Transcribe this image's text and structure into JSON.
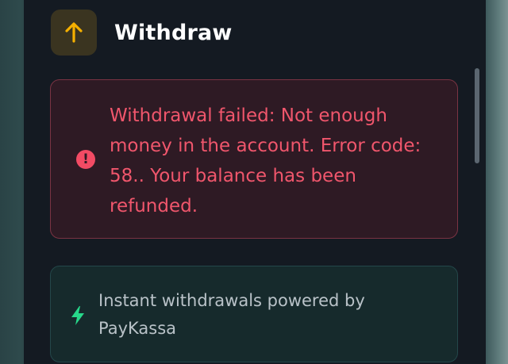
{
  "header": {
    "title": "Withdraw",
    "icon": "arrow-up-icon",
    "icon_color": "#f5b000"
  },
  "error": {
    "message": "Withdrawal failed: Not enough money in the account. Error code: 58.. Your balance has been refunded.",
    "icon": "exclamation-circle-icon",
    "color": "#f0566c"
  },
  "info": {
    "message": "Instant withdrawals powered by PayKassa",
    "icon": "lightning-bolt-icon",
    "icon_color": "#27d88a"
  }
}
